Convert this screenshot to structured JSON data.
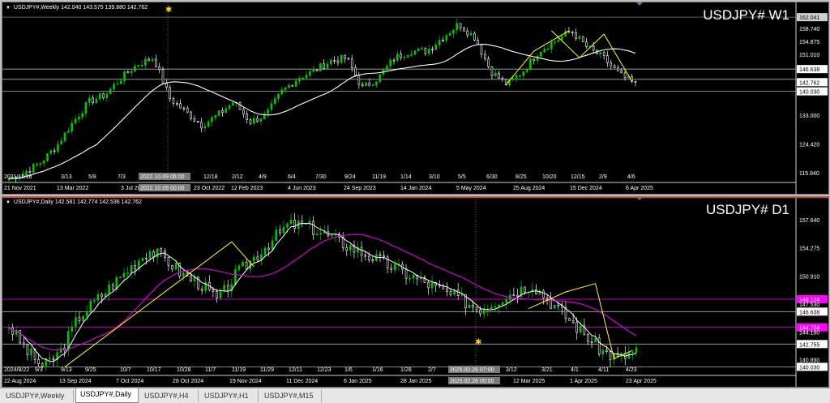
{
  "weekly": {
    "header": "USDJPY#,Weekly  142.040 143.575 139.880 142.762",
    "big_label": "USDJPY# W1",
    "price_labels": [
      "162.041",
      "158.740",
      "154.875",
      "151.010",
      "146.638",
      "142.762",
      "140.030",
      "133.000",
      "124.420",
      "115.840"
    ],
    "date_labels": [
      "21 Nov 2021",
      "13 Mar 2022",
      "3 Jul 2022",
      "23 Oct 2022",
      "12 Feb 2023",
      "4 Jun 2023",
      "24 Sep 2023",
      "14 Jan 2024",
      "5 May 2024",
      "25 Aug 2024",
      "15 Dec 2024",
      "6 Apr 2025"
    ],
    "upper_date_labels": [
      "2021/11/16",
      "3/13",
      "5/8",
      "7/3",
      "2022.10.09 06:00",
      "12/18",
      "2/12",
      "4/9",
      "6/4",
      "7/30",
      "9/24",
      "11/19",
      "1/14",
      "3/10",
      "5/5",
      "6/30",
      "8/25",
      "10/20",
      "12/15",
      "2/9",
      "4/6"
    ],
    "crosshair_date": "2022.10.09 00:00"
  },
  "daily": {
    "header": "USDJPY#,Daily  142.581 142.774 142.536 142.762",
    "big_label": "USDJPY# D1",
    "price_labels": [
      "157.640",
      "154.275",
      "150.910",
      "148.124",
      "147.530",
      "146.638",
      "144.754",
      "144.180",
      "142.755",
      "140.890",
      "140.030"
    ],
    "date_labels": [
      "22 Aug 2024",
      "13 Sep 2024",
      "7 Oct 2024",
      "28 Oct 2024",
      "19 Nov 2024",
      "11 Dec 2024",
      "6 Jan 2025",
      "28 Jan 2025",
      "2025.02.26 00:00",
      "12 Mar 2025",
      "1 Apr 2025",
      "23 Apr 2025"
    ],
    "upper_date_labels": [
      "2024/8/22",
      "9/3",
      "9/13",
      "9/25",
      "10/7",
      "10/17",
      "10/28",
      "11/7",
      "11/19",
      "11/29",
      "12/11",
      "12/23",
      "1/6",
      "1/16",
      "1/28",
      "2/7",
      "2025.02.26 07:00",
      "3/12",
      "3/21",
      "4/1",
      "4/11",
      "4/23"
    ]
  },
  "tabs": [
    "USDJPY#,Weekly",
    "USDJPY#,Daily",
    "USDJPY#,H4",
    "USDJPY#,H1",
    "USDJPY#,M15"
  ],
  "active_tab": "USDJPY#,Daily",
  "colors": {
    "bull": "#00c800",
    "bear": "#ffffff",
    "ma_white": "#ffffff",
    "ma_magenta": "#e000e0",
    "zigzag": "#ffff00",
    "hline": "#b0b0b0",
    "magenta_line": "#ff00ff"
  }
}
